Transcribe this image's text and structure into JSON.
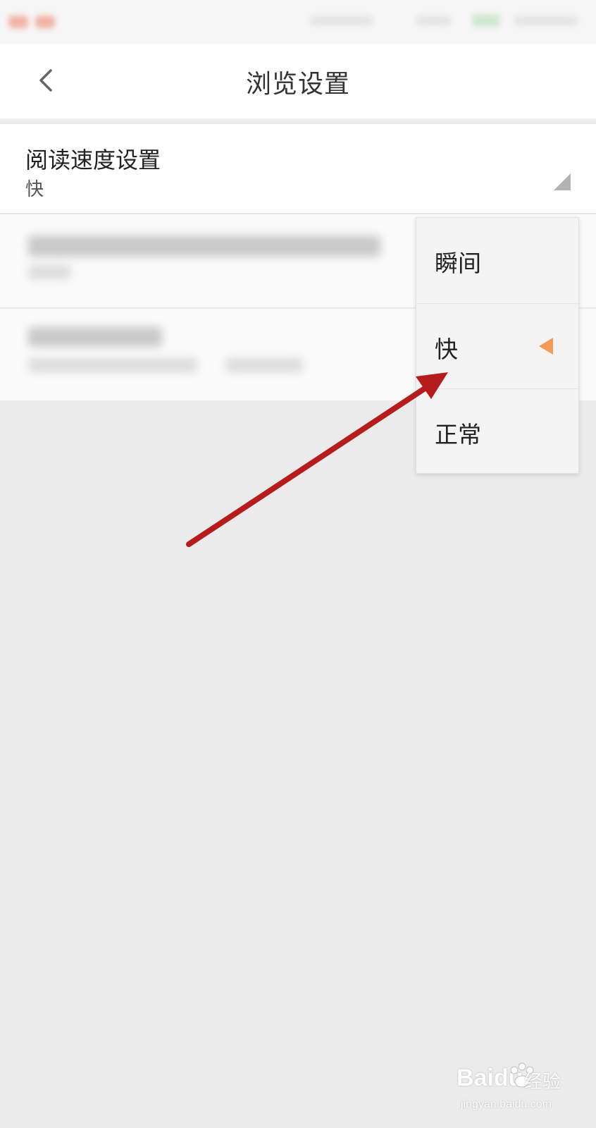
{
  "header": {
    "title": "浏览设置",
    "back_icon": "chevron-left-icon"
  },
  "setting": {
    "title": "阅读速度设置",
    "value": "快"
  },
  "menu": {
    "items": [
      {
        "label": "瞬间",
        "selected": false
      },
      {
        "label": "快",
        "selected": true
      },
      {
        "label": "正常",
        "selected": false
      }
    ],
    "selected_marker_color": "#f59a55"
  },
  "annotation": {
    "arrow_color": "#b71c1c"
  },
  "watermark": {
    "logo": "Baidu",
    "brand": "经验",
    "url": "jingyan.baidu.com"
  }
}
